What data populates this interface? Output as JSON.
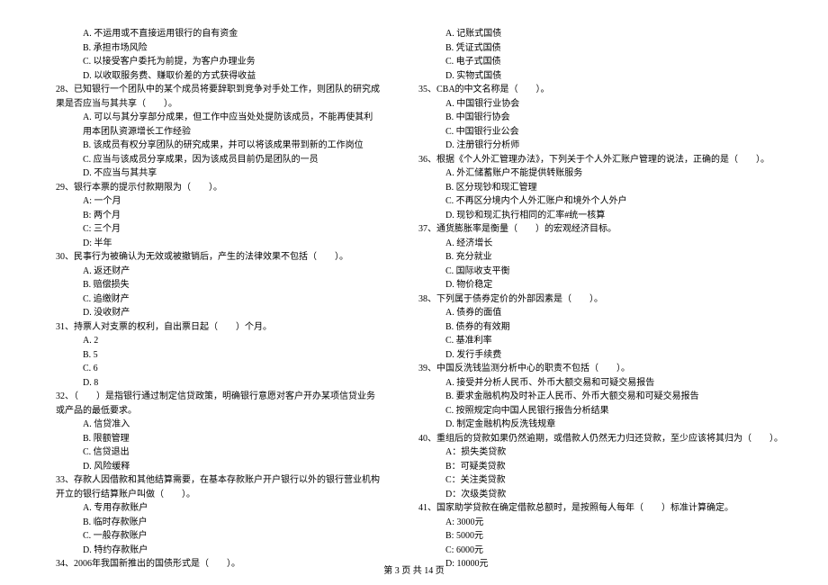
{
  "left": {
    "opt_a27": "A. 不运用或不直接运用银行的自有资金",
    "opt_b27": "B. 承担市场风险",
    "opt_c27": "C. 以接受客户委托为前提，为客户办理业务",
    "opt_d27": "D. 以收取服务费、赚取价差的方式获得收益",
    "q28": "28、已知银行一个团队中的某个成员将要辞职到竞争对手处工作，则团队的研究成果是否应当与其共享（　　）。",
    "q28a": "A. 可以与其分享部分成果，但工作中应当处处提防该成员，不能再使其利用本团队资源增长工作经验",
    "q28b": "B. 该成员有权分享团队的研究成果，并可以将该成果带到新的工作岗位",
    "q28c": "C. 应当与该成员分享成果，因为该成员目前仍是团队的一员",
    "q28d": "D. 不应当与其共享",
    "q29": "29、银行本票的提示付款期限为（　　）。",
    "q29a": "A: 一个月",
    "q29b": "B: 两个月",
    "q29c": "C: 三个月",
    "q29d": "D: 半年",
    "q30": "30、民事行为被确认为无效或被撤销后，产生的法律效果不包括（　　）。",
    "q30a": "A. 返还财产",
    "q30b": "B. 赔偿损失",
    "q30c": "C. 追缴财产",
    "q30d": "D. 没收财产",
    "q31": "31、持票人对支票的权利，自出票日起（　　）个月。",
    "q31a": "A. 2",
    "q31b": "B. 5",
    "q31c": "C. 6",
    "q31d": "D. 8",
    "q32": "32、（　　）是指银行通过制定信贷政策，明确银行意愿对客户开办某项信贷业务或产品的最低要求。",
    "q32a": "A. 信贷准入",
    "q32b": "B. 限额管理",
    "q32c": "C. 信贷退出",
    "q32d": "D. 风险缓释",
    "q33": "33、存款人因借款和其他结算需要，在基本存款账户开户银行以外的银行营业机构开立的银行结算账户叫做（　　）。",
    "q33a": "A. 专用存款账户",
    "q33b": "B. 临时存款账户",
    "q33c": "C. 一般存款账户",
    "q33d": "D. 特约存款账户",
    "q34": "34、2006年我国新推出的国债形式是（　　）。"
  },
  "right": {
    "q34a": "A. 记账式国债",
    "q34b": "B. 凭证式国债",
    "q34c": "C. 电子式国债",
    "q34d": "D. 实物式国债",
    "q35": "35、CBA的中文名称是（　　）。",
    "q35a": "A. 中国银行业协会",
    "q35b": "B. 中国银行协会",
    "q35c": "C. 中国银行业公会",
    "q35d": "D. 注册银行分析师",
    "q36": "36、根据《个人外汇管理办法》，下列关于个人外汇账户管理的说法，正确的是（　　）。",
    "q36a": "A. 外汇储蓄账户不能提供转账服务",
    "q36b": "B. 区分现钞和现汇管理",
    "q36c": "C. 不再区分境内个人外汇账户和境外个人外户",
    "q36d": "D. 现钞和现汇执行相同的汇率#统一核算",
    "q37": "37、通货膨胀率是衡量（　　）的宏观经济目标。",
    "q37a": "A. 经济增长",
    "q37b": "B. 充分就业",
    "q37c": "C. 国际收支平衡",
    "q37d": "D. 物价稳定",
    "q38": "38、下列属于债券定价的外部因素是（　　）。",
    "q38a": "A. 债券的面值",
    "q38b": "B. 债券的有效期",
    "q38c": "C. 基准利率",
    "q38d": "D. 发行手续费",
    "q39": "39、中国反洗钱监测分析中心的职责不包括（　　）。",
    "q39a": "A. 接受并分析人民币、外币大额交易和可疑交易报告",
    "q39b": "B. 要求金融机构及时补正人民币、外币大额交易和可疑交易报告",
    "q39c": "C. 按照规定向中国人民银行报告分析结果",
    "q39d": "D. 制定金融机构反洗钱规章",
    "q40": "40、重组后的贷款如果仍然逾期，或借款人仍然无力归还贷款，至少应该将其归为（　　）。",
    "q40a": "A：损失类贷款",
    "q40b": "B：可疑类贷款",
    "q40c": "C：关注类贷款",
    "q40d": "D：次级类贷款",
    "q41": "41、国家助学贷款在确定借款总额时，是按照每人每年（　　）标准计算确定。",
    "q41a": "A: 3000元",
    "q41b": "B: 5000元",
    "q41c": "C: 6000元",
    "q41d": "D: 10000元"
  },
  "footer": "第 3 页 共 14 页"
}
